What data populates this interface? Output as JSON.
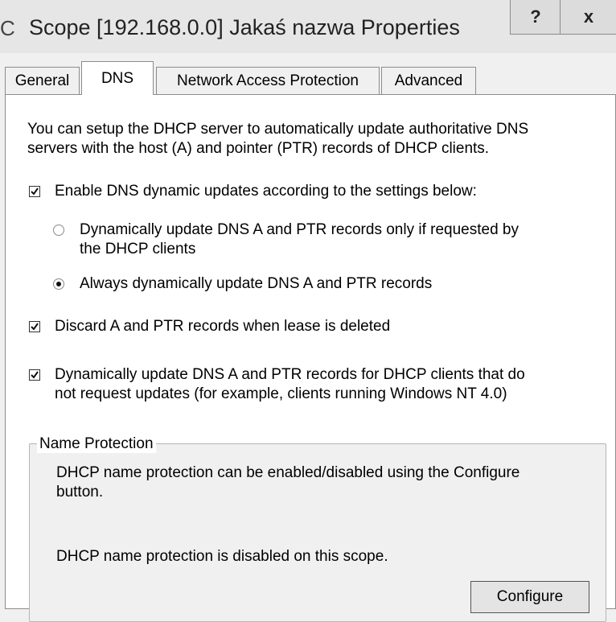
{
  "window": {
    "title": "Scope [192.168.0.0] Jakaś nazwa Properties",
    "edge_glyph": "C",
    "help_label": "?",
    "close_label": "x"
  },
  "tabs": [
    {
      "label": "General",
      "active": false
    },
    {
      "label": "DNS",
      "active": true
    },
    {
      "label": "Network Access Protection",
      "active": false
    },
    {
      "label": "Advanced",
      "active": false
    }
  ],
  "dns": {
    "intro_line1": "You can setup the DHCP server to automatically update authoritative DNS",
    "intro_line2": "servers with the host (A) and pointer (PTR) records of DHCP clients.",
    "enable_updates": {
      "label": "Enable DNS dynamic updates according to the settings below:",
      "checked": true
    },
    "radio_requested": {
      "line1": "Dynamically update DNS A and PTR records only if requested by",
      "line2": "the DHCP clients",
      "selected": false
    },
    "radio_always": {
      "label": "Always dynamically update DNS A and PTR records",
      "selected": true
    },
    "discard_records": {
      "label": "Discard A and PTR records when lease is deleted",
      "checked": true
    },
    "update_nonrequesting": {
      "line1": "Dynamically update DNS A and PTR records for DHCP clients that do",
      "line2": "not request updates (for example, clients running Windows NT 4.0)",
      "checked": true
    }
  },
  "name_protection": {
    "legend": "Name Protection",
    "desc_line1": "DHCP name protection can be enabled/disabled using the Configure",
    "desc_line2": "button.",
    "status": "DHCP name protection is disabled on this scope.",
    "configure_label": "Configure"
  },
  "colors": {
    "window_bg": "#f0f0f0",
    "panel_bg": "#ffffff",
    "border": "#8c8c8c"
  },
  "icons": {
    "check": "checkmark-icon",
    "radio_dot": "radio-dot-icon"
  }
}
